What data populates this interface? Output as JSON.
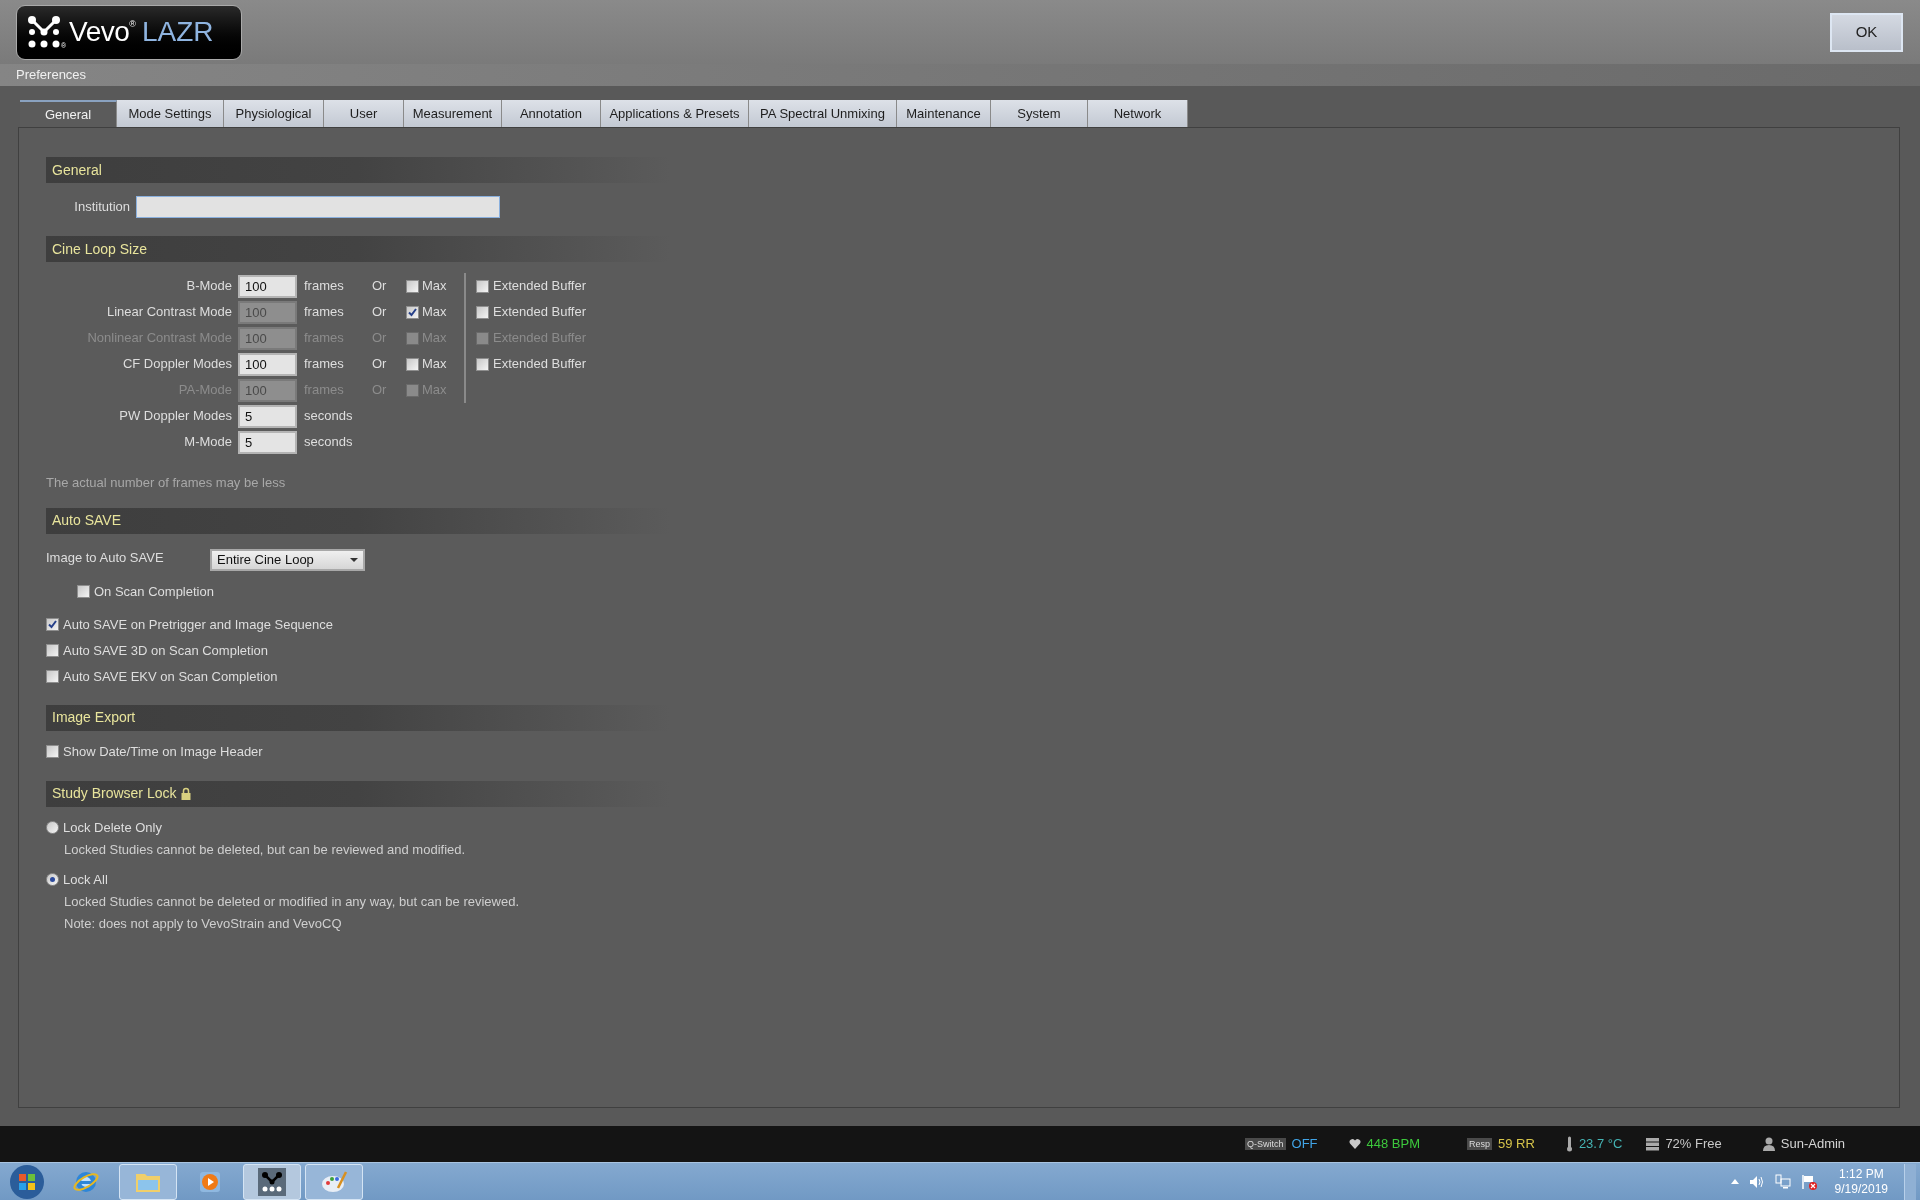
{
  "header": {
    "logo_word": "Vevo",
    "logo_reg": "®",
    "logo_product": "LAZR",
    "logo_dots_reg": "®",
    "ok_button": "OK"
  },
  "breadcrumb": "Preferences",
  "tabs": [
    {
      "label": "General",
      "selected": true
    },
    {
      "label": "Mode Settings",
      "selected": false
    },
    {
      "label": "Physiological",
      "selected": false
    },
    {
      "label": "User",
      "selected": false
    },
    {
      "label": "Measurement",
      "selected": false
    },
    {
      "label": "Annotation",
      "selected": false
    },
    {
      "label": "Applications & Presets",
      "selected": false
    },
    {
      "label": "PA Spectral Unmixing",
      "selected": false
    },
    {
      "label": "Maintenance",
      "selected": false
    },
    {
      "label": "System",
      "selected": false
    },
    {
      "label": "Network",
      "selected": false
    }
  ],
  "general": {
    "title": "General",
    "institution_label": "Institution"
  },
  "cine_loop": {
    "title": "Cine Loop Size",
    "rows": [
      {
        "label": "B-Mode",
        "value": "100",
        "unit": "frames",
        "disabled": false,
        "or": "Or",
        "max": {
          "label": "Max",
          "checked": false
        },
        "extended": {
          "label": "Extended Buffer",
          "checked": false
        }
      },
      {
        "label": "Linear Contrast Mode",
        "value": "100",
        "unit": "frames",
        "disabled": false,
        "or": "Or",
        "max": {
          "label": "Max",
          "checked": true
        },
        "extended": {
          "label": "Extended Buffer",
          "checked": false
        }
      },
      {
        "label": "Nonlinear Contrast Mode",
        "value": "100",
        "unit": "frames",
        "disabled": true,
        "or": "Or",
        "max": {
          "label": "Max",
          "checked": false
        },
        "extended": {
          "label": "Extended Buffer",
          "checked": false
        }
      },
      {
        "label": "CF Doppler Modes",
        "value": "100",
        "unit": "frames",
        "disabled": false,
        "or": "Or",
        "max": {
          "label": "Max",
          "checked": false
        },
        "extended": {
          "label": "Extended Buffer",
          "checked": false
        }
      },
      {
        "label": "PA-Mode",
        "value": "100",
        "unit": "frames",
        "disabled": true,
        "or": "Or",
        "max": {
          "label": "Max",
          "checked": false
        }
      },
      {
        "label": "PW Doppler Modes",
        "value": "5",
        "unit": "seconds",
        "disabled": false
      },
      {
        "label": "M-Mode",
        "value": "5",
        "unit": "seconds",
        "disabled": false
      }
    ],
    "note": "The actual number of frames may be less"
  },
  "auto_save": {
    "title": "Auto SAVE",
    "image_label": "Image to Auto SAVE",
    "image_value": "Entire Cine Loop",
    "on_scan": {
      "label": "On Scan Completion",
      "checked": false
    },
    "options": [
      {
        "label": "Auto SAVE on Pretrigger and Image Sequence",
        "checked": true
      },
      {
        "label": "Auto SAVE 3D on Scan Completion",
        "checked": false
      },
      {
        "label": "Auto SAVE EKV on Scan Completion",
        "checked": false
      }
    ]
  },
  "image_export": {
    "title": "Image Export",
    "options": [
      {
        "label": "Show Date/Time on Image Header",
        "checked": false
      }
    ]
  },
  "study_lock": {
    "title": "Study Browser Lock",
    "options": [
      {
        "label": "Lock Delete Only",
        "selected": false,
        "notes": [
          "Locked Studies cannot be deleted, but can be reviewed and modified."
        ]
      },
      {
        "label": "Lock All",
        "selected": true,
        "notes": [
          "Locked Studies cannot be deleted or modified in any way, but can be reviewed.",
          "Note: does not apply to VevoStrain and VevoCQ"
        ]
      }
    ]
  },
  "status_bar": [
    {
      "kind": "badge",
      "badge": "Q-Switch",
      "value": "OFF",
      "color": "#41a4e6"
    },
    {
      "kind": "heart",
      "value": "448 BPM",
      "color": "#3cc83c"
    },
    {
      "kind": "badge",
      "badge": "Resp",
      "value": "59 RR",
      "color": "#d6c44a"
    },
    {
      "kind": "thermometer",
      "value": "23.7 °C",
      "color": "#45b3b3"
    },
    {
      "kind": "disk",
      "value": "72% Free",
      "color": "#c8c8c8"
    },
    {
      "kind": "user",
      "value": "Sun-Admin",
      "color": "#d4d4d4"
    }
  ],
  "taskbar": {
    "apps": [
      {
        "kind": "browser",
        "open": false,
        "active": false
      },
      {
        "kind": "folder",
        "open": true,
        "active": false
      },
      {
        "kind": "media",
        "open": false,
        "active": false
      },
      {
        "kind": "dots",
        "open": true,
        "active": true
      },
      {
        "kind": "paint",
        "open": true,
        "active": false
      }
    ],
    "clock_time": "1:12 PM",
    "clock_date": "9/19/2019"
  }
}
